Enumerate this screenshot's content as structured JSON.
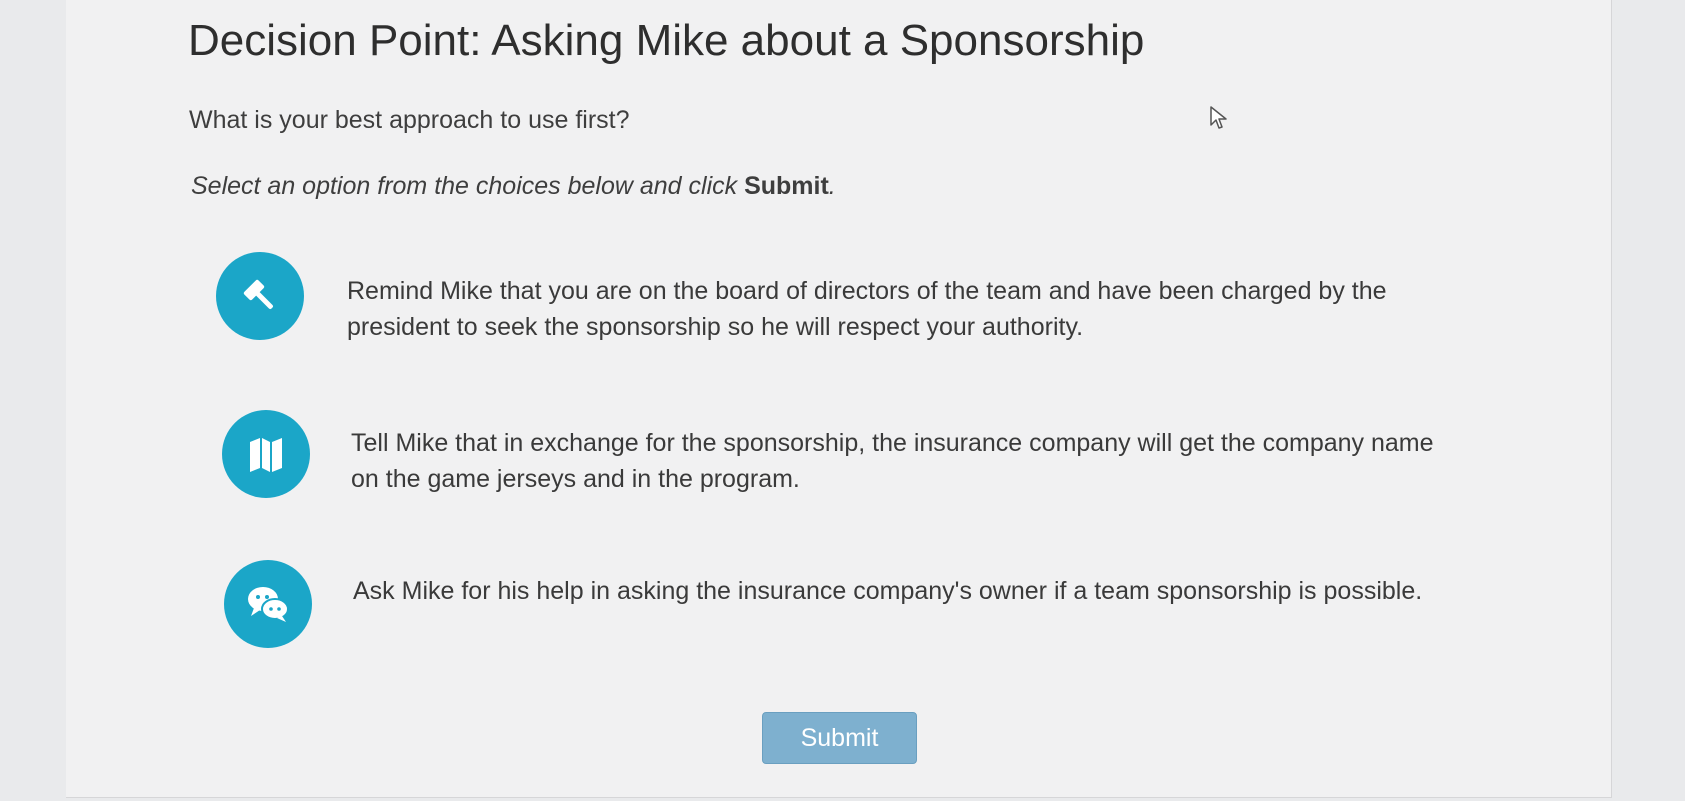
{
  "header": {
    "title": "Decision Point: Asking Mike about a Sponsorship"
  },
  "prompt": {
    "question": "What is your best approach to use first?",
    "instruction_prefix": "Select an option from the choices below and click ",
    "instruction_action": "Submit",
    "instruction_suffix": "."
  },
  "options": [
    {
      "icon": "gavel-icon",
      "text": "Remind Mike that you are on the board of directors of the team and have been charged by the president to seek the sponsorship so he will respect your authority."
    },
    {
      "icon": "map-icon",
      "text": "Tell Mike that in exchange for the sponsorship, the insurance company will get the company name on the game jerseys and in the program."
    },
    {
      "icon": "chat-bubbles-icon",
      "text": "Ask Mike for his help in asking the insurance company's owner if a team sponsorship is possible."
    }
  ],
  "actions": {
    "submit_label": "Submit"
  },
  "colors": {
    "accent": "#1ba6c8",
    "submit_button": "#7eb0cf",
    "background": "#f1f1f2"
  }
}
